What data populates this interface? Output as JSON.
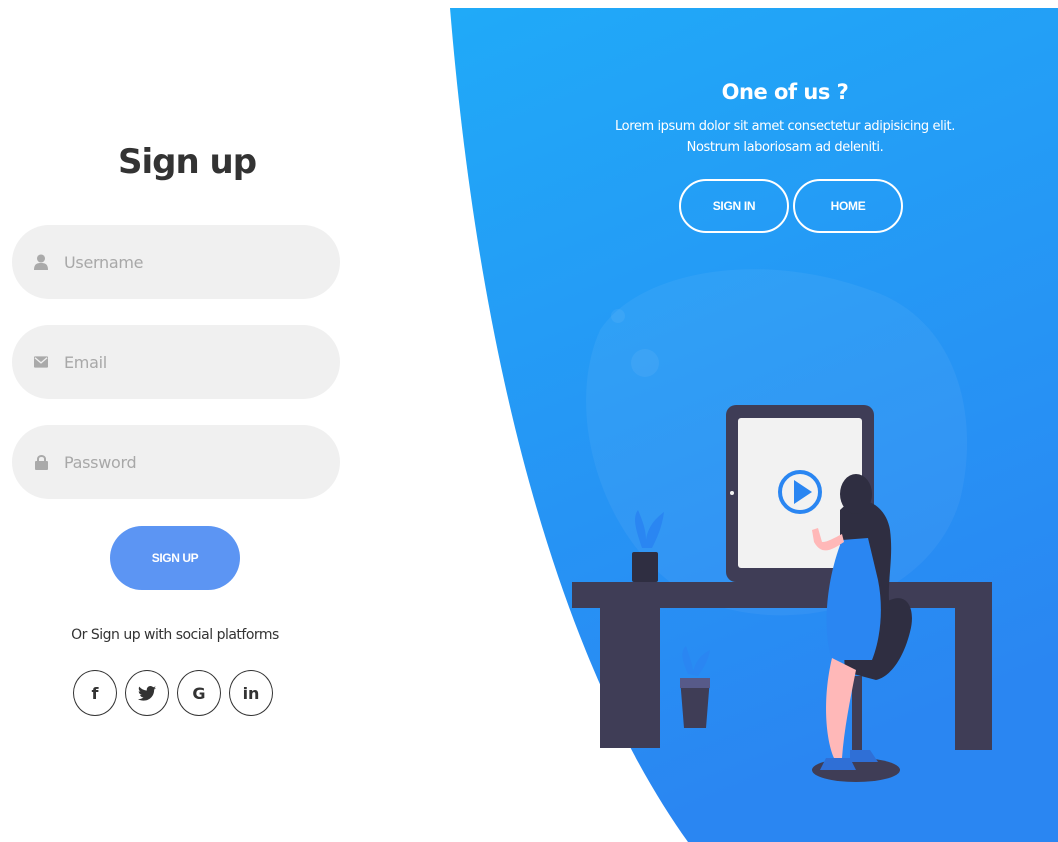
{
  "signup_form": {
    "title": "Sign up",
    "username_placeholder": "Username",
    "email_placeholder": "Email",
    "password_placeholder": "Password",
    "submit_label": "SIGN UP",
    "social_text": "Or Sign up with social platforms",
    "social_links": [
      {
        "label": "f",
        "icon": "facebook-icon"
      },
      {
        "label": "G",
        "icon": "google-icon"
      },
      {
        "label": "in",
        "icon": "linkedin-icon"
      }
    ],
    "twitter_icon": "twitter-icon"
  },
  "right_panel": {
    "title": "One of us ?",
    "text_line1": "Lorem ipsum dolor sit amet consectetur adipisicing elit.",
    "text_line2": "Nostrum laboriosam ad deleniti.",
    "sign_in_label": "SIGN IN",
    "home_label": "HOME"
  },
  "colors": {
    "panel_gradient_start": "#20aaf8",
    "panel_gradient_end": "#2a86f2",
    "signup_button": "#5c95f3",
    "input_background": "#f0f0f0",
    "title_text": "#333333"
  }
}
